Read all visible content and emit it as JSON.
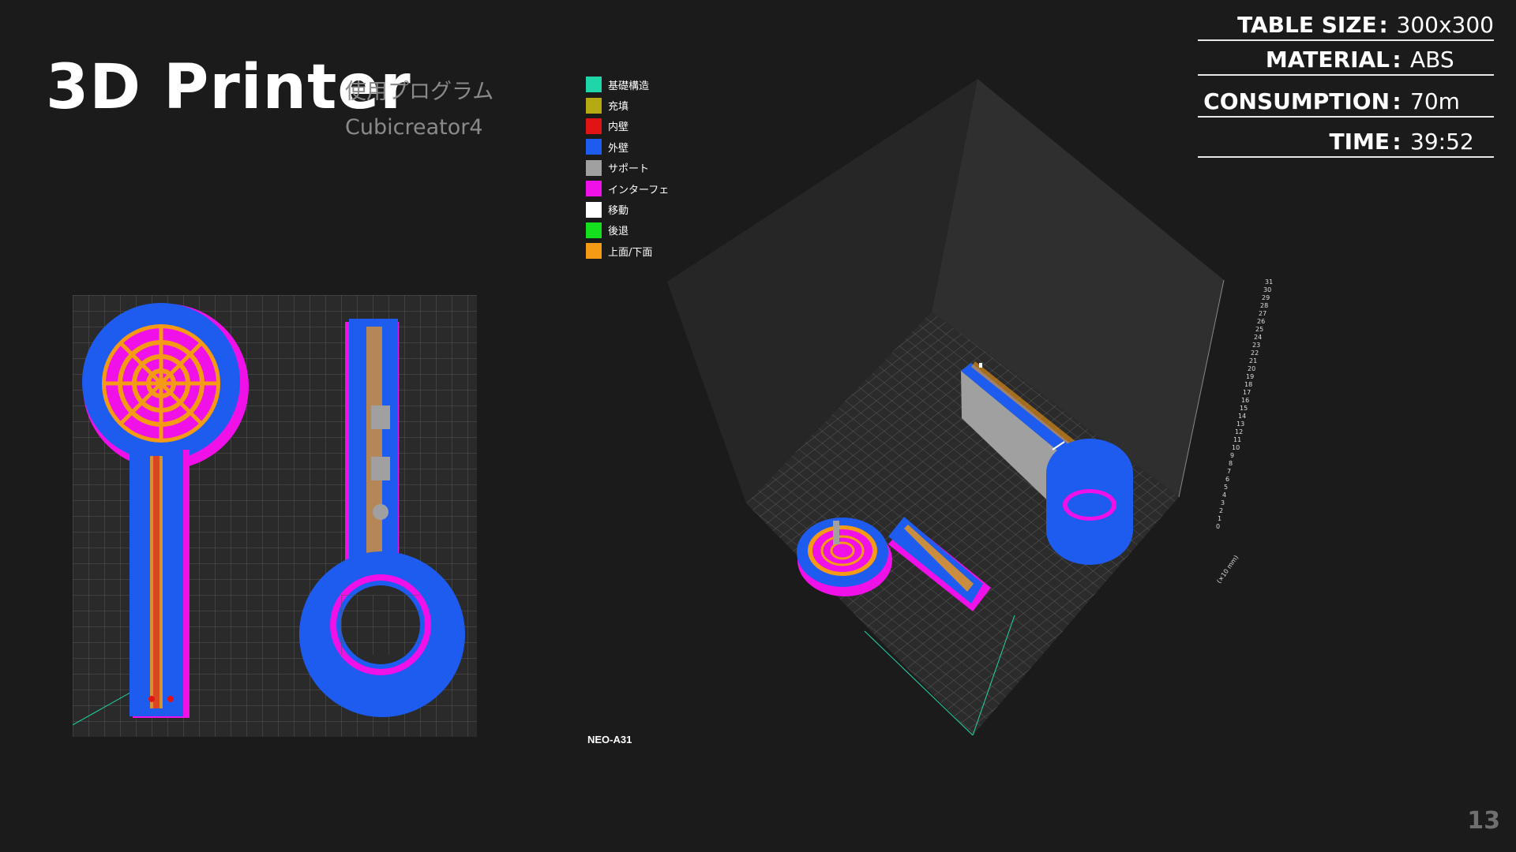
{
  "header": {
    "title": "3D Printer",
    "subtitle": "使用プログラム",
    "program": "Cubicreator4"
  },
  "legend": [
    {
      "label": "基礎構造",
      "color": "#1ed6a7"
    },
    {
      "label": "充填",
      "color": "#b5a914"
    },
    {
      "label": "内壁",
      "color": "#e01414"
    },
    {
      "label": "外壁",
      "color": "#1e5cf0"
    },
    {
      "label": "サポート",
      "color": "#a0a0a0"
    },
    {
      "label": "インターフェ",
      "color": "#f010e8"
    },
    {
      "label": "移動",
      "color": "#ffffff"
    },
    {
      "label": "後退",
      "color": "#14e01e"
    },
    {
      "label": "上面/下面",
      "color": "#f59a14"
    }
  ],
  "model_label": "NEO-A31",
  "info": [
    {
      "key": "TABLE SIZE",
      "value": "300x300"
    },
    {
      "key": "MATERIAL",
      "value": "ABS"
    },
    {
      "key": "CONSUMPTION",
      "value": "70m"
    },
    {
      "key": "TIME",
      "value": "39:52"
    }
  ],
  "page_number": "13",
  "iso_axis": {
    "z_ticks": [
      "31",
      "30",
      "29",
      "28",
      "27",
      "26",
      "25",
      "24",
      "23",
      "22",
      "21",
      "20",
      "19",
      "18",
      "17",
      "16",
      "15",
      "14",
      "13",
      "12",
      "11",
      "10",
      "9",
      "8",
      "7",
      "6",
      "5",
      "4",
      "3",
      "2",
      "1",
      "0"
    ],
    "unit": "(×10 mm)"
  }
}
